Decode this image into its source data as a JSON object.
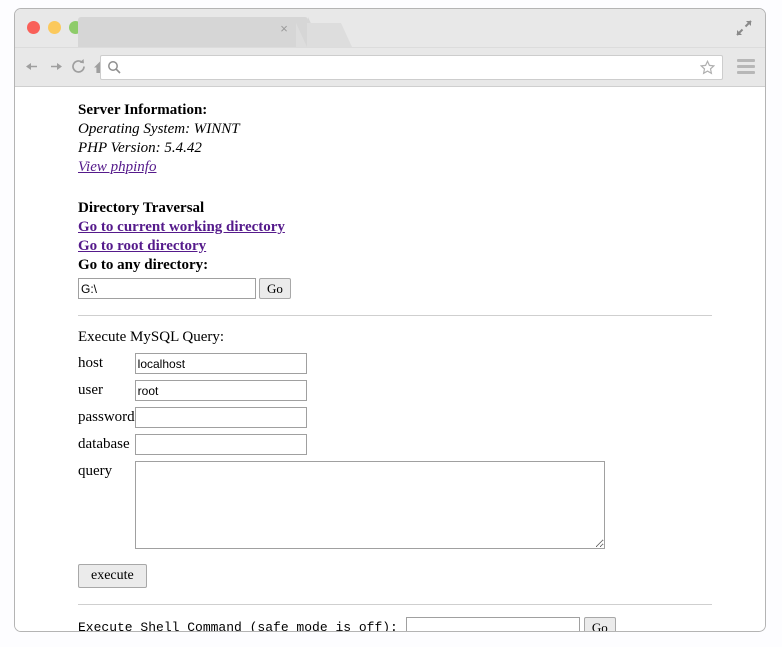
{
  "browser": {
    "traffic_lights": [
      {
        "name": "close",
        "color": "#f96059"
      },
      {
        "name": "minimize",
        "color": "#fbc95d"
      },
      {
        "name": "zoom",
        "color": "#8ecc6a"
      }
    ],
    "tab": {
      "title": "",
      "close_label": "×"
    },
    "urlbar": {
      "value": "",
      "placeholder": ""
    }
  },
  "page": {
    "server_info": {
      "heading": "Server Information:",
      "os_line": "Operating System: WINNT",
      "php_line": "PHP Version: 5.4.42",
      "phpinfo_link": "View phpinfo"
    },
    "directory_traversal": {
      "heading": "Directory Traversal",
      "cwd_link": "Go to current working directory",
      "root_link": "Go to root directory",
      "any_label": "Go to any directory:",
      "path_value": "G:\\",
      "go_label": "Go"
    },
    "mysql": {
      "heading": "Execute MySQL Query:",
      "fields": [
        {
          "label": "host",
          "value": "localhost"
        },
        {
          "label": "user",
          "value": "root"
        },
        {
          "label": "password",
          "value": ""
        },
        {
          "label": "database",
          "value": ""
        }
      ],
      "query_label": "query",
      "query_value": "",
      "execute_label": "execute"
    },
    "shell": {
      "label": "Execute Shell Command (safe mode is off):",
      "value": "",
      "go_label": "Go"
    }
  },
  "colors": {
    "link": "#551a8b",
    "chrome": "#e8e8e8",
    "tab": "#d6d6d6"
  }
}
